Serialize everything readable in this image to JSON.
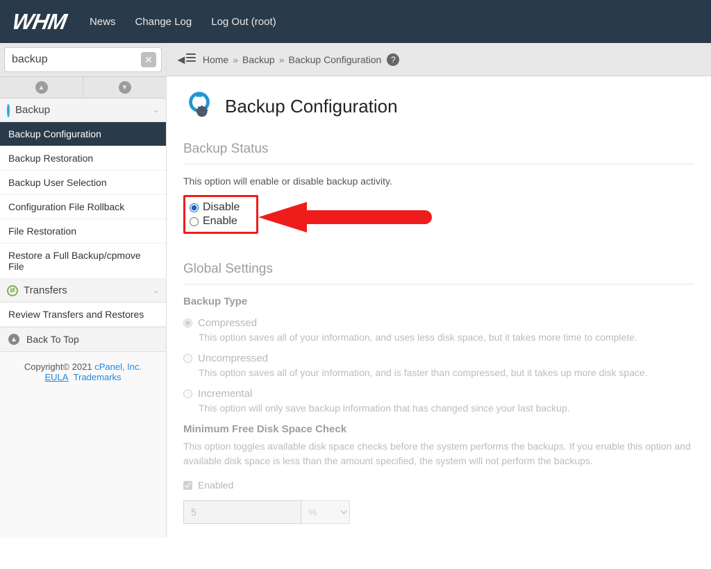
{
  "topbar": {
    "logo": "WHM",
    "links": {
      "news": "News",
      "changelog": "Change Log",
      "logout": "Log Out (root)"
    }
  },
  "search": {
    "value": "backup"
  },
  "sidebar": {
    "groups": [
      {
        "label": "Backup",
        "items": [
          {
            "label": "Backup Configuration",
            "active": true
          },
          {
            "label": "Backup Restoration"
          },
          {
            "label": "Backup User Selection"
          },
          {
            "label": "Configuration File Rollback"
          },
          {
            "label": "File Restoration"
          },
          {
            "label": "Restore a Full Backup/cpmove File"
          }
        ]
      },
      {
        "label": "Transfers",
        "items": [
          {
            "label": "Review Transfers and Restores"
          }
        ]
      }
    ],
    "back_to_top": "Back To Top"
  },
  "footer": {
    "copyright": "Copyright© 2021 ",
    "cpanel": "cPanel, Inc.",
    "eula": "EULA",
    "trademarks": "Trademarks"
  },
  "breadcrumb": {
    "home": "Home",
    "backup": "Backup",
    "current": "Backup Configuration"
  },
  "page": {
    "title": "Backup Configuration",
    "status": {
      "heading": "Backup Status",
      "desc": "This option will enable or disable backup activity.",
      "disable": "Disable",
      "enable": "Enable"
    },
    "global": {
      "heading": "Global Settings",
      "type_label": "Backup Type",
      "options": [
        {
          "label": "Compressed",
          "desc": "This option saves all of your information, and uses less disk space, but it takes more time to complete."
        },
        {
          "label": "Uncompressed",
          "desc": "This option saves all of your information, and is faster than compressed, but it takes up more disk space."
        },
        {
          "label": "Incremental",
          "desc": "This option will only save backup information that has changed since your last backup."
        }
      ],
      "minfree": {
        "title": "Minimum Free Disk Space Check",
        "desc": "This option toggles available disk space checks before the system performs the backups. If you enable this option and available disk space is less than the amount specified, the system will not perform the backups.",
        "enabled": "Enabled",
        "value": "5",
        "unit": "%"
      }
    }
  }
}
